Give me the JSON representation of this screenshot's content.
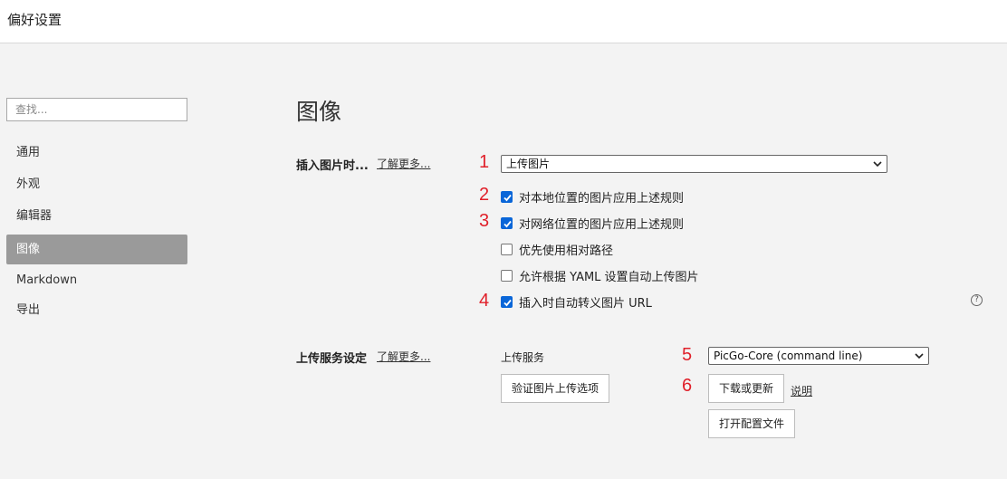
{
  "window": {
    "title": "偏好设置"
  },
  "sidebar": {
    "search_placeholder": "查找...",
    "items": [
      {
        "label": "通用",
        "active": false
      },
      {
        "label": "外观",
        "active": false
      },
      {
        "label": "编辑器",
        "active": false
      },
      {
        "label": "图像",
        "active": true
      },
      {
        "label": "Markdown",
        "active": false
      },
      {
        "label": "导出",
        "active": false
      }
    ]
  },
  "main": {
    "title": "图像",
    "insert_section": {
      "label": "插入图片时...",
      "learn_more": "了解更多...",
      "action_select": "上传图片",
      "options": [
        {
          "label": "对本地位置的图片应用上述规则",
          "checked": true
        },
        {
          "label": "对网络位置的图片应用上述规则",
          "checked": true
        },
        {
          "label": "优先使用相对路径",
          "checked": false
        },
        {
          "label": "允许根据 YAML 设置自动上传图片",
          "checked": false
        },
        {
          "label": "插入时自动转义图片 URL",
          "checked": true
        }
      ],
      "help_icon": "?"
    },
    "upload_section": {
      "label": "上传服务设定",
      "learn_more": "了解更多...",
      "service_label": "上传服务",
      "service_select": "PicGo-Core (command line)",
      "verify_button": "验证图片上传选项",
      "download_button": "下载或更新",
      "explain_link": "说明",
      "open_config_button": "打开配置文件"
    }
  },
  "markers": [
    "1",
    "2",
    "3",
    "4",
    "5",
    "6"
  ],
  "colors": {
    "accent": "#0a66d8",
    "marker": "#e0202a",
    "active_nav": "#9a9a9a"
  }
}
